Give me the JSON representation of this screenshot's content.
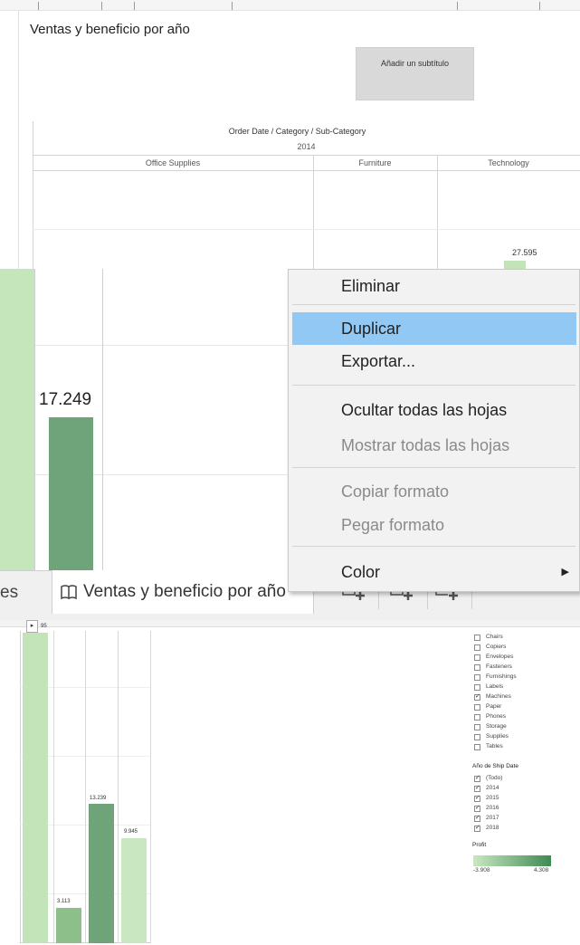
{
  "dashboard": {
    "title": "Ventas y beneficio por año",
    "subtitle_placeholder": "Añadir un subtítulo",
    "header": "Order Date / Category / Sub-Category",
    "year": "2014",
    "categories": [
      "Office Supplies",
      "Furniture",
      "Technology"
    ],
    "top_value": "27.595"
  },
  "zoom": {
    "value_label": "17.249"
  },
  "context_menu": {
    "items": [
      {
        "label": "Eliminar",
        "enabled": true
      },
      {
        "label": "Duplicar",
        "enabled": true,
        "highlighted": true
      },
      {
        "label": "Exportar...",
        "enabled": true
      },
      {
        "label": "Ocultar todas las hojas",
        "enabled": true
      },
      {
        "label": "Mostrar todas las hojas",
        "enabled": false
      },
      {
        "label": "Copiar formato",
        "enabled": false
      },
      {
        "label": "Pegar formato",
        "enabled": false
      },
      {
        "label": "Color",
        "enabled": true,
        "submenu": true
      }
    ]
  },
  "tabs": {
    "previous_tab_fragment": "es",
    "active_tab": "Ventas y beneficio por año",
    "tool_icons": [
      "new-worksheet-icon",
      "new-dashboard-icon",
      "new-story-icon"
    ]
  },
  "lower": {
    "first_label_fragment": "95",
    "bar_labels": [
      "3.113",
      "13.239",
      "9.945"
    ],
    "subcategory_filter": {
      "items": [
        {
          "label": "Chairs",
          "checked": false
        },
        {
          "label": "Copiers",
          "checked": false
        },
        {
          "label": "Envelopes",
          "checked": false
        },
        {
          "label": "Fasteners",
          "checked": false
        },
        {
          "label": "Furnishings",
          "checked": false
        },
        {
          "label": "Labels",
          "checked": false
        },
        {
          "label": "Machines",
          "checked": true
        },
        {
          "label": "Paper",
          "checked": false
        },
        {
          "label": "Phones",
          "checked": false
        },
        {
          "label": "Storage",
          "checked": false
        },
        {
          "label": "Supplies",
          "checked": false
        },
        {
          "label": "Tables",
          "checked": false
        }
      ]
    },
    "ship_date_filter": {
      "title": "Año de Ship Date",
      "items": [
        {
          "label": "(Todo)",
          "checked": true
        },
        {
          "label": "2014",
          "checked": true
        },
        {
          "label": "2015",
          "checked": true
        },
        {
          "label": "2016",
          "checked": true
        },
        {
          "label": "2017",
          "checked": true
        },
        {
          "label": "2018",
          "checked": true
        }
      ]
    },
    "profit_legend": {
      "title": "Profit",
      "min": "-3.908",
      "max": "4.308",
      "color_low": "#c9e8c2",
      "color_high": "#3f8a55"
    }
  },
  "colors": {
    "bar_light": "#c2e4b8",
    "bar_mid": "#8cbf89",
    "bar_dark": "#6fa37a",
    "menu_highlight": "#91c8f4"
  }
}
